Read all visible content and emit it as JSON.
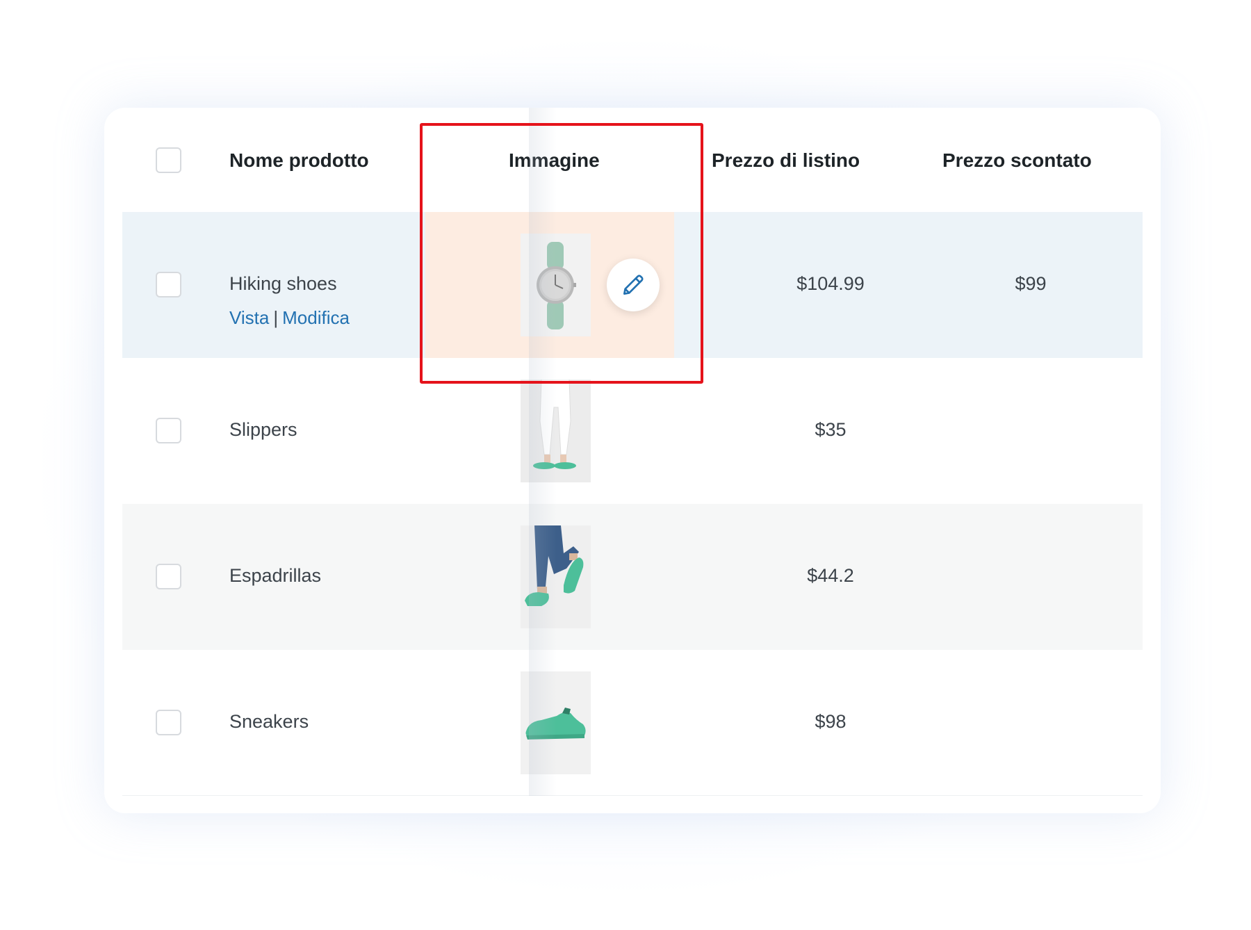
{
  "table": {
    "headers": {
      "name": "Nome prodotto",
      "image": "Immagine",
      "list_price": "Prezzo di listino",
      "sale_price": "Prezzo scontato"
    },
    "rows": [
      {
        "name": "Hiking shoes",
        "image": "watch",
        "list_price": "$104.99",
        "sale_price": "$99",
        "actions": {
          "view": "Vista",
          "edit": "Modifica"
        }
      },
      {
        "name": "Slippers",
        "image": "slippers",
        "list_price": "$35",
        "sale_price": ""
      },
      {
        "name": "Espadrillas",
        "image": "espadrillas",
        "list_price": "$44.2",
        "sale_price": ""
      },
      {
        "name": "Sneakers",
        "image": "sneakers",
        "list_price": "$98",
        "sale_price": ""
      }
    ]
  },
  "icons": {
    "edit": "pencil-icon"
  },
  "colors": {
    "accent": "#2271b1",
    "highlight_border": "#e5131b",
    "active_row": "#ecf3f8",
    "image_cell_hover": "#fdece1",
    "alt_row": "#f6f7f7",
    "product_green": "#4dbf9a"
  }
}
